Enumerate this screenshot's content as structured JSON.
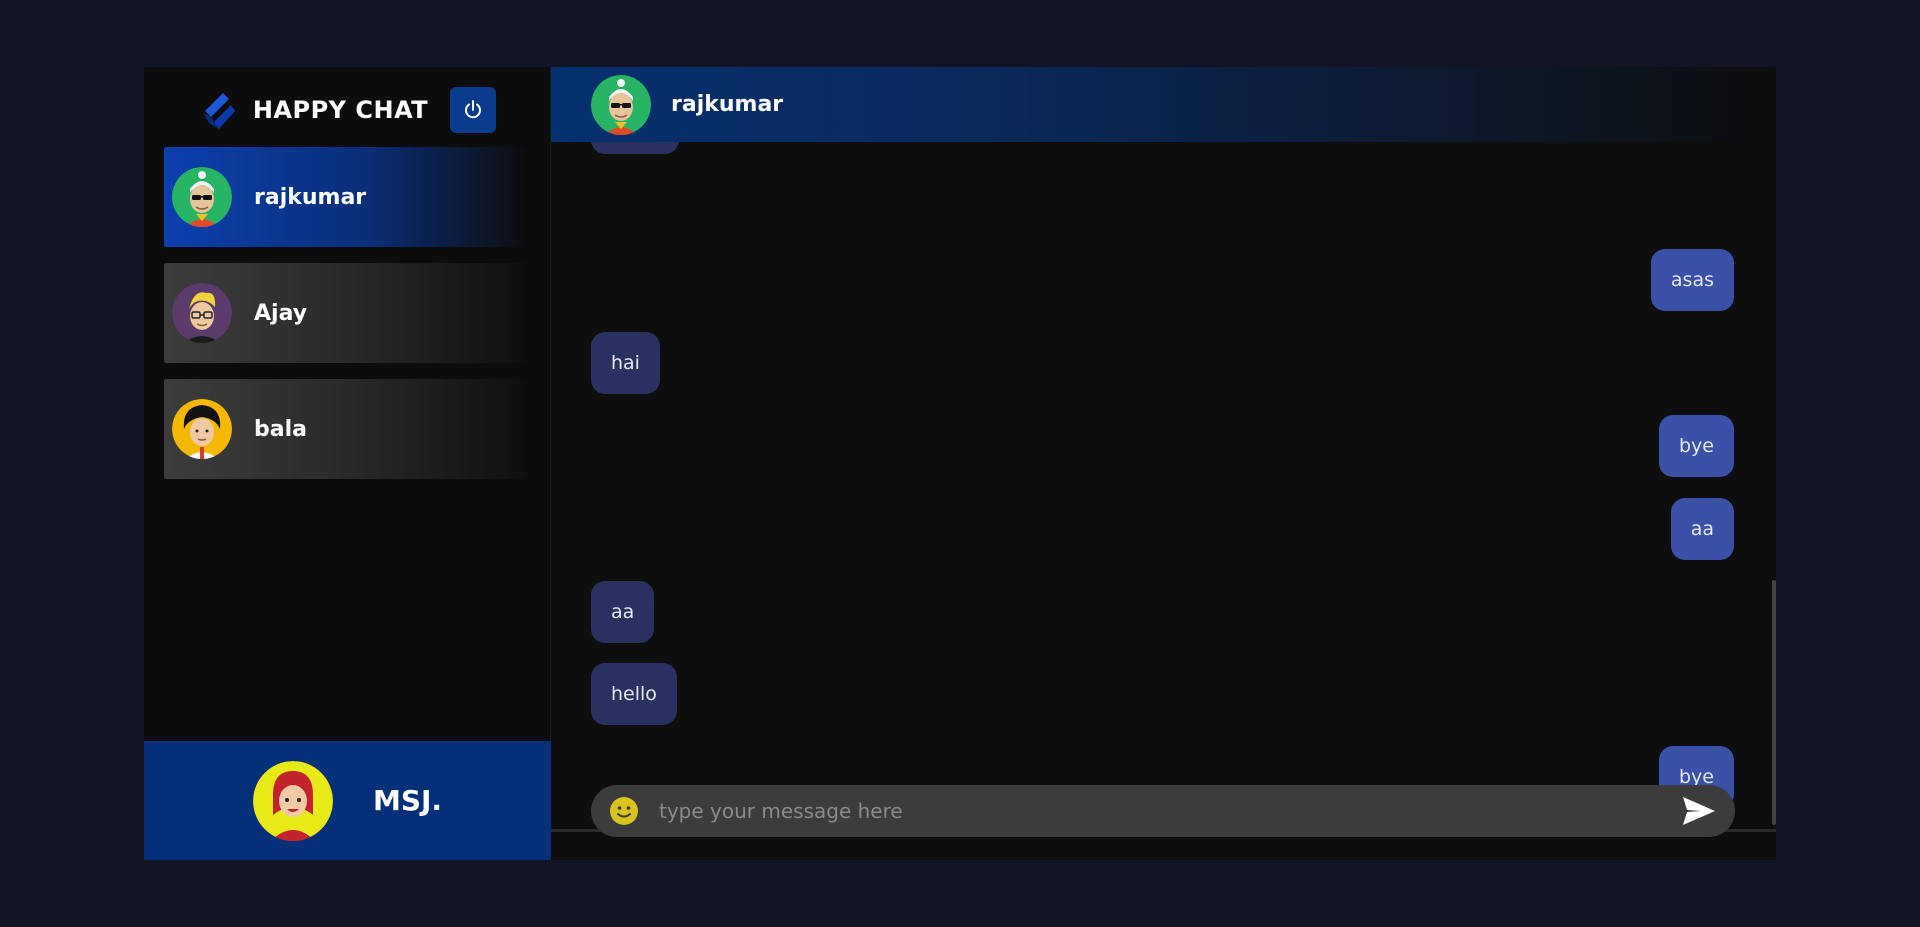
{
  "app": {
    "title": "HAPPY CHAT"
  },
  "contacts": [
    {
      "name": "rajkumar",
      "active": true
    },
    {
      "name": "Ajay",
      "active": false
    },
    {
      "name": "bala",
      "active": false
    }
  ],
  "me": {
    "name": "MSJ."
  },
  "chat": {
    "recipient": "rajkumar",
    "messages": [
      {
        "text": "asas",
        "direction": "out"
      },
      {
        "text": "hai",
        "direction": "in"
      },
      {
        "text": "bye",
        "direction": "out"
      },
      {
        "text": "aa",
        "direction": "out"
      },
      {
        "text": "aa",
        "direction": "in"
      },
      {
        "text": "hello",
        "direction": "in"
      },
      {
        "text": "bye",
        "direction": "out"
      }
    ],
    "composer": {
      "placeholder": "type your message here",
      "value": ""
    }
  },
  "colors": {
    "background": "#121426",
    "accent": "#0a3b8c",
    "incoming_bubble": "#293160",
    "outgoing_bubble": "#3a51a7"
  },
  "icons": [
    "brand-logo-icon",
    "power-icon",
    "emoji-icon",
    "send-icon"
  ]
}
